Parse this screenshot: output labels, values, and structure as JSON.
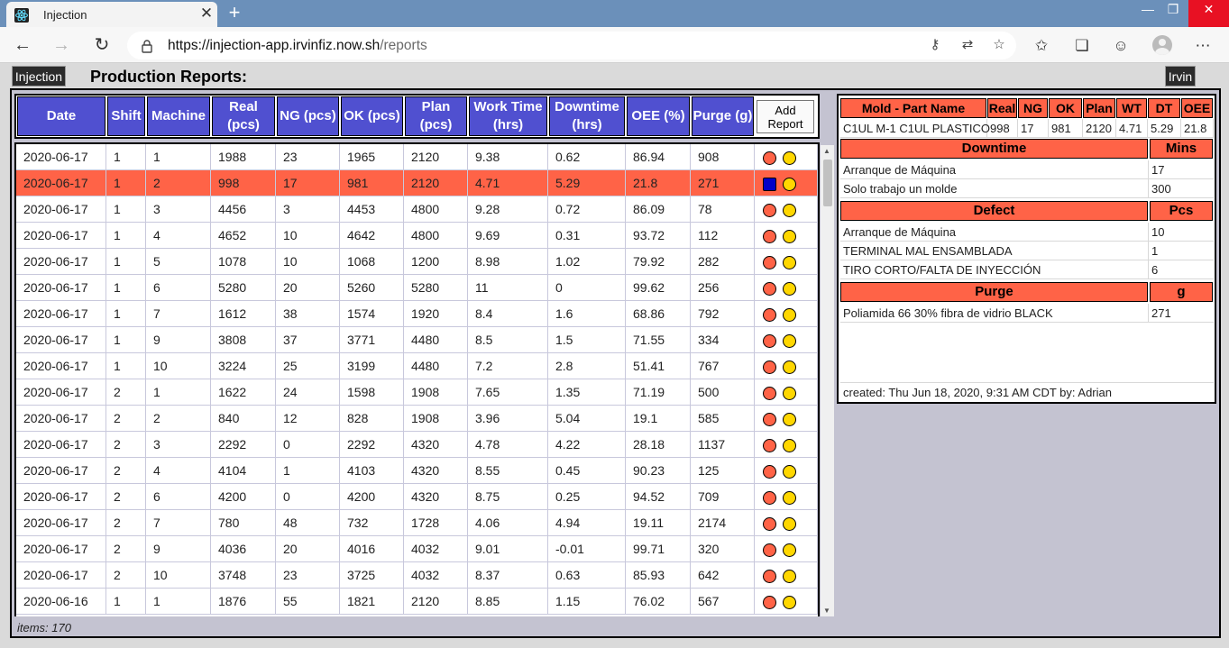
{
  "browser": {
    "tab_title": "Injection",
    "tab_close": "✕",
    "new_tab": "+",
    "url_host": "https://injection-app.irvinfiz.now.sh",
    "url_path": "/reports",
    "min": "—",
    "max": "❐",
    "close": "✕"
  },
  "app": {
    "brand": "Injection",
    "page_title": "Production Reports:",
    "user": "Irvin",
    "items_label": "items: 170"
  },
  "table": {
    "headers": [
      "Date",
      "Shift",
      "Machine",
      "Real (pcs)",
      "NG (pcs)",
      "OK (pcs)",
      "Plan (pcs)",
      "Work Time (hrs)",
      "Downtime (hrs)",
      "OEE (%)",
      "Purge (g)"
    ],
    "add_button": "Add Report",
    "rows": [
      [
        "2020-06-17",
        "1",
        "1",
        "1988",
        "23",
        "1965",
        "2120",
        "9.38",
        "0.62",
        "86.94",
        "908"
      ],
      [
        "2020-06-17",
        "1",
        "2",
        "998",
        "17",
        "981",
        "2120",
        "4.71",
        "5.29",
        "21.8",
        "271"
      ],
      [
        "2020-06-17",
        "1",
        "3",
        "4456",
        "3",
        "4453",
        "4800",
        "9.28",
        "0.72",
        "86.09",
        "78"
      ],
      [
        "2020-06-17",
        "1",
        "4",
        "4652",
        "10",
        "4642",
        "4800",
        "9.69",
        "0.31",
        "93.72",
        "112"
      ],
      [
        "2020-06-17",
        "1",
        "5",
        "1078",
        "10",
        "1068",
        "1200",
        "8.98",
        "1.02",
        "79.92",
        "282"
      ],
      [
        "2020-06-17",
        "1",
        "6",
        "5280",
        "20",
        "5260",
        "5280",
        "11",
        "0",
        "99.62",
        "256"
      ],
      [
        "2020-06-17",
        "1",
        "7",
        "1612",
        "38",
        "1574",
        "1920",
        "8.4",
        "1.6",
        "68.86",
        "792"
      ],
      [
        "2020-06-17",
        "1",
        "9",
        "3808",
        "37",
        "3771",
        "4480",
        "8.5",
        "1.5",
        "71.55",
        "334"
      ],
      [
        "2020-06-17",
        "1",
        "10",
        "3224",
        "25",
        "3199",
        "4480",
        "7.2",
        "2.8",
        "51.41",
        "767"
      ],
      [
        "2020-06-17",
        "2",
        "1",
        "1622",
        "24",
        "1598",
        "1908",
        "7.65",
        "1.35",
        "71.19",
        "500"
      ],
      [
        "2020-06-17",
        "2",
        "2",
        "840",
        "12",
        "828",
        "1908",
        "3.96",
        "5.04",
        "19.1",
        "585"
      ],
      [
        "2020-06-17",
        "2",
        "3",
        "2292",
        "0",
        "2292",
        "4320",
        "4.78",
        "4.22",
        "28.18",
        "1137"
      ],
      [
        "2020-06-17",
        "2",
        "4",
        "4104",
        "1",
        "4103",
        "4320",
        "8.55",
        "0.45",
        "90.23",
        "125"
      ],
      [
        "2020-06-17",
        "2",
        "6",
        "4200",
        "0",
        "4200",
        "4320",
        "8.75",
        "0.25",
        "94.52",
        "709"
      ],
      [
        "2020-06-17",
        "2",
        "7",
        "780",
        "48",
        "732",
        "1728",
        "4.06",
        "4.94",
        "19.11",
        "2174"
      ],
      [
        "2020-06-17",
        "2",
        "9",
        "4036",
        "20",
        "4016",
        "4032",
        "9.01",
        "-0.01",
        "99.71",
        "320"
      ],
      [
        "2020-06-17",
        "2",
        "10",
        "3748",
        "23",
        "3725",
        "4032",
        "8.37",
        "0.63",
        "85.93",
        "642"
      ],
      [
        "2020-06-16",
        "1",
        "1",
        "1876",
        "55",
        "1821",
        "2120",
        "8.85",
        "1.15",
        "76.02",
        "567"
      ]
    ],
    "selected_row": 1
  },
  "detail": {
    "summary_headers": [
      "Mold - Part Name",
      "Real",
      "NG",
      "OK",
      "Plan",
      "WT",
      "DT",
      "OEE"
    ],
    "summary_values": [
      "C1UL M-1 C1UL PLASTICO",
      "998",
      "17",
      "981",
      "2120",
      "4.71",
      "5.29",
      "21.8"
    ],
    "downtime": {
      "title": "Downtime",
      "unit": "Mins",
      "items": [
        {
          "name": "Arranque de Máquina",
          "value": "17"
        },
        {
          "name": "Solo trabajo un molde",
          "value": "300"
        }
      ]
    },
    "defect": {
      "title": "Defect",
      "unit": "Pcs",
      "items": [
        {
          "name": "Arranque de Máquina",
          "value": "10"
        },
        {
          "name": "TERMINAL MAL ENSAMBLADA",
          "value": "1"
        },
        {
          "name": "TIRO CORTO/FALTA DE INYECCIÓN",
          "value": "6"
        }
      ]
    },
    "purge": {
      "title": "Purge",
      "unit": "g",
      "items": [
        {
          "name": "Poliamida 66 30% fibra de vidrio BLACK",
          "value": "271"
        }
      ]
    },
    "created": "created: Thu Jun 18, 2020, 9:31 AM CDT by: Adrian"
  },
  "colors": {
    "header_blue": "#5050d0",
    "selected_row": "#ff6347",
    "status_red": "#ff6347",
    "status_yellow": "#ffd700",
    "status_blue": "#0000c8"
  }
}
